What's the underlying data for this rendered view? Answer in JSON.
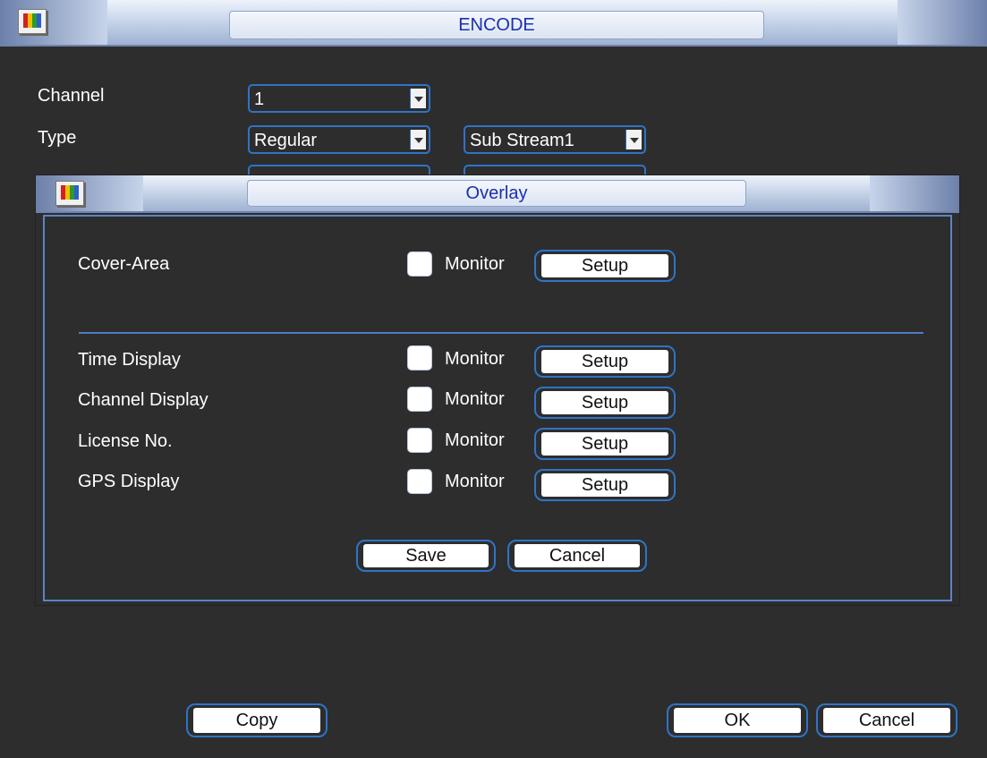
{
  "window": {
    "title": "ENCODE",
    "channel_label": "Channel",
    "channel_value": "1",
    "type_label": "Type",
    "type_value": "Regular",
    "stream_value": "Sub Stream1",
    "copy_label": "Copy",
    "ok_label": "OK",
    "cancel_label": "Cancel"
  },
  "overlay": {
    "title": "Overlay",
    "rows": [
      {
        "label": "Cover-Area",
        "monitor": "Monitor",
        "setup": "Setup",
        "checked": false
      },
      {
        "label": "Time Display",
        "monitor": "Monitor",
        "setup": "Setup",
        "checked": false
      },
      {
        "label": "Channel Display",
        "monitor": "Monitor",
        "setup": "Setup",
        "checked": false
      },
      {
        "label": "License No.",
        "monitor": "Monitor",
        "setup": "Setup",
        "checked": false
      },
      {
        "label": "GPS Display",
        "monitor": "Monitor",
        "setup": "Setup",
        "checked": false
      }
    ],
    "save_label": "Save",
    "cancel_label": "Cancel"
  },
  "colors": {
    "background": "#2d2d2d",
    "accent_border": "#2f74c7",
    "title_text": "#1b2fb0"
  },
  "icons": [
    "app-monitor-icon",
    "dropdown-arrow-icon"
  ]
}
